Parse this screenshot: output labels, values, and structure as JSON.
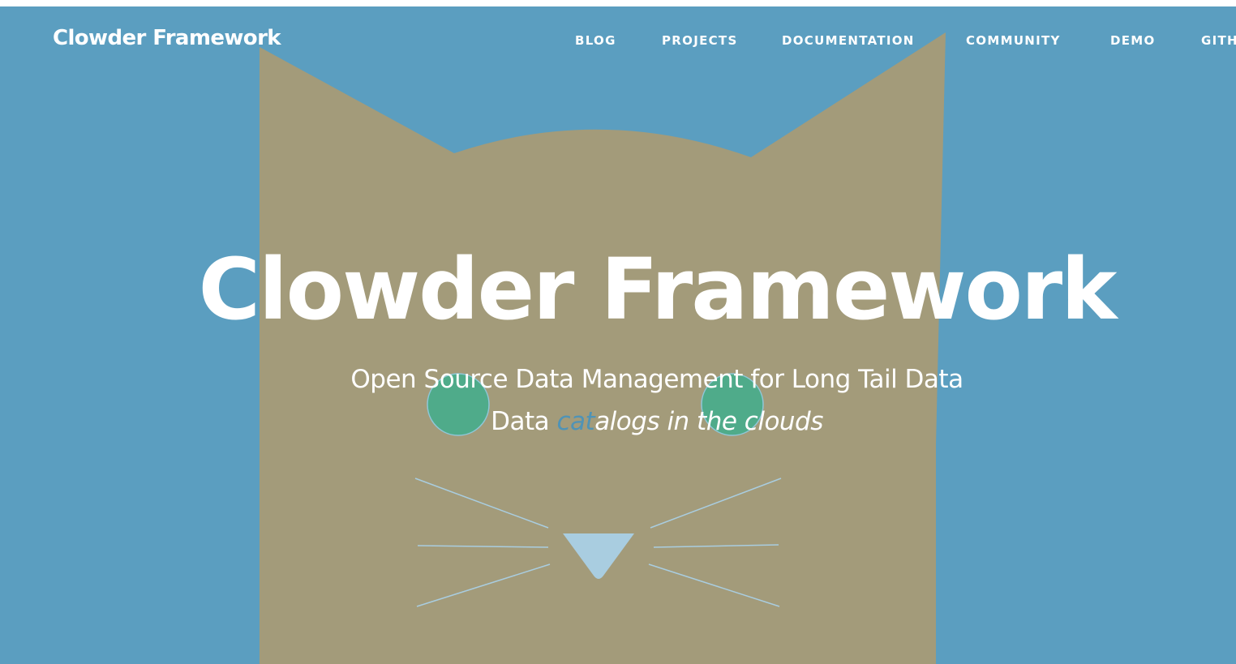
{
  "navbar": {
    "brand": "Clowder Framework",
    "links": [
      "BLOG",
      "PROJECTS",
      "DOCUMENTATION",
      "COMMUNITY",
      "DEMO",
      "GITH"
    ]
  },
  "hero": {
    "title": "Clowder Framework",
    "subtitle": "Open Source Data Management for Long Tail Data",
    "tagline_prefix": "Data ",
    "tagline_highlight": "cat",
    "tagline_suffix": "alogs in the clouds"
  },
  "colors": {
    "background": "#5b9ec0",
    "cat_face": "#a39b7a",
    "cat_eyes": "#4fab8a",
    "cat_nose": "#a9cde0",
    "whiskers": "#a9cde0",
    "highlight_text": "#4f93b6"
  },
  "icons": {
    "hero_art": "cat-face-illustration"
  }
}
